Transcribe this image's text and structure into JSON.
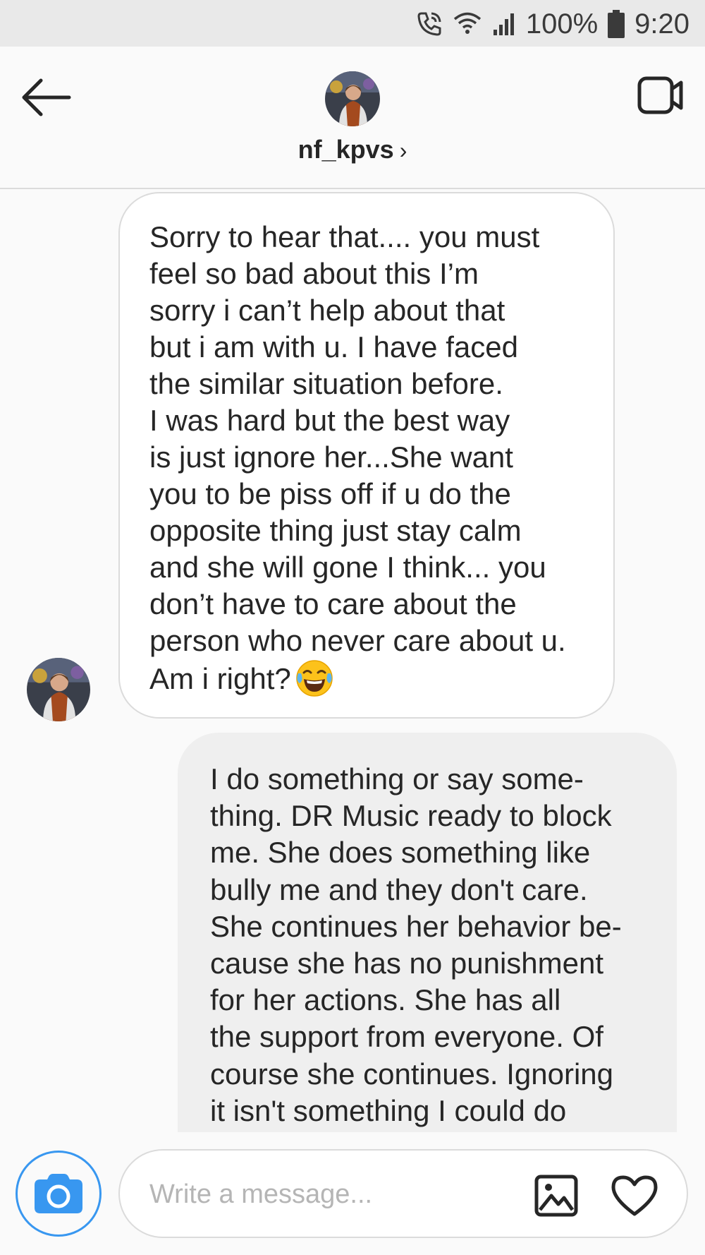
{
  "status_bar": {
    "battery": "100%",
    "time": "9:20",
    "icons": [
      "call-icon",
      "wifi-icon",
      "signal-icon",
      "battery-icon"
    ]
  },
  "header": {
    "username": "nf_kpvs",
    "chevron": "›",
    "icons": [
      "back-arrow-icon",
      "video-call-icon",
      "avatar"
    ]
  },
  "messages": [
    {
      "direction": "incoming",
      "text": "Sorry to hear that.... you must\nfeel so bad about this I’m\nsorry i can’t help about that\nbut i am with u. I have faced\nthe similar situation before.\nI was hard but the best way\nis just ignore her...She want\nyou to be piss off if u do the\nopposite thing just stay calm\nand she will gone I think... you\ndon’t have to care about the\nperson who never care about u.\nAm i right?",
      "emoji": "face-with-tears-of-joy"
    },
    {
      "direction": "outgoing",
      "text": "I do something or say some-\nthing. DR Music ready to block\nme. She does something like\nbully me and they don't care.\nShe continues her behavior be-\ncause she has no punishment\nfor her actions. She has all\nthe support from everyone. Of\ncourse she continues. Ignoring\nit isn't something I could do"
    }
  ],
  "composer": {
    "placeholder": "Write a message...",
    "icons": [
      "camera-icon",
      "gallery-icon",
      "heart-icon"
    ]
  },
  "colors": {
    "accent": "#3897f0",
    "outgoing_bubble": "#efefef",
    "border": "#dbdbdb"
  }
}
